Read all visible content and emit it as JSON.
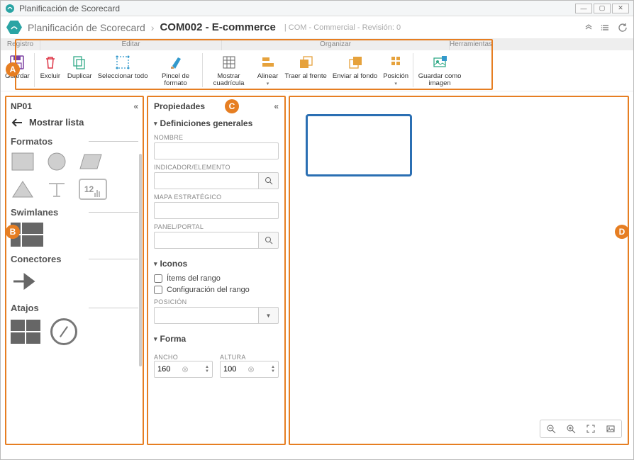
{
  "window": {
    "title": "Planificación de Scorecard"
  },
  "breadcrumb": {
    "a": "Planificación de Scorecard",
    "b": "COM002 - E-commerce",
    "meta": "COM - Commercial - Revisión: 0"
  },
  "toolbar_tabs": {
    "registro": "Registro",
    "editar": "Editar",
    "organizar": "Organizar",
    "herramientas": "Herramientas"
  },
  "toolbar": {
    "guardar": "Guardar",
    "excluir": "Excluir",
    "duplicar": "Duplicar",
    "seleccionar": "Seleccionar todo",
    "pincel": "Pincel de formato",
    "cuadricula": "Mostrar cuadrícula",
    "alinear": "Alinear",
    "frente": "Traer al frente",
    "fondo": "Enviar al fondo",
    "posicion": "Posición",
    "imagen": "Guardar como imagen"
  },
  "panelB": {
    "title": "NP01",
    "back": "Mostrar lista",
    "formatos": "Formatos",
    "chip": "12",
    "swimlanes": "Swimlanes",
    "conectores": "Conectores",
    "atajos": "Atajos"
  },
  "panelC": {
    "title": "Propiedades",
    "sec_general": "Definiciones generales",
    "lbl_nombre": "NOMBRE",
    "lbl_indicador": "INDICADOR/ELEMENTO",
    "lbl_mapa": "MAPA ESTRATÉGICO",
    "lbl_panel": "PANEL/PORTAL",
    "sec_iconos": "Iconos",
    "chk_items": "Ítems del rango",
    "chk_config": "Configuración del rango",
    "lbl_posicion": "POSICIÓN",
    "sec_forma": "Forma",
    "lbl_ancho": "ANCHO",
    "lbl_altura": "ALTURA",
    "val_ancho": "160",
    "val_altura": "100"
  },
  "markers": {
    "a": "A",
    "b": "B",
    "c": "C",
    "d": "D"
  }
}
